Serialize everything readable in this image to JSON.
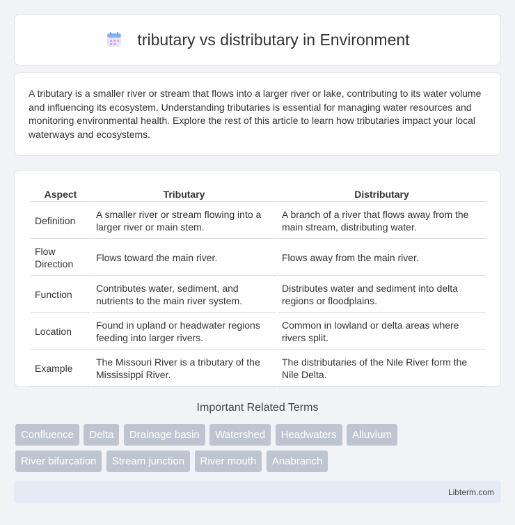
{
  "header": {
    "title": "tributary vs distributary in Environment",
    "icon": "calendar-icon"
  },
  "intro": {
    "text": "A tributary is a smaller river or stream that flows into a larger river or lake, contributing to its water volume and influencing its ecosystem. Understanding tributaries is essential for managing water resources and monitoring environmental health. Explore the rest of this article to learn how tributaries impact your local waterways and ecosystems."
  },
  "table": {
    "headers": [
      "Aspect",
      "Tributary",
      "Distributary"
    ],
    "rows": [
      [
        "Definition",
        "A smaller river or stream flowing into a larger river or main stem.",
        "A branch of a river that flows away from the main stream, distributing water."
      ],
      [
        "Flow Direction",
        "Flows toward the main river.",
        "Flows away from the main river."
      ],
      [
        "Function",
        "Contributes water, sediment, and nutrients to the main river system.",
        "Distributes water and sediment into delta regions or floodplains."
      ],
      [
        "Location",
        "Found in upland or headwater regions feeding into larger rivers.",
        "Common in lowland or delta areas where rivers split."
      ],
      [
        "Example",
        "The Missouri River is a tributary of the Mississippi River.",
        "The distributaries of the Nile River form the Nile Delta."
      ]
    ]
  },
  "related": {
    "title": "Important Related Terms",
    "terms": [
      "Confluence",
      "Delta",
      "Drainage basin",
      "Watershed",
      "Headwaters",
      "Alluvium",
      "River bifurcation",
      "Stream junction",
      "River mouth",
      "Anabranch"
    ]
  },
  "footer": {
    "text": "Libterm.com"
  }
}
